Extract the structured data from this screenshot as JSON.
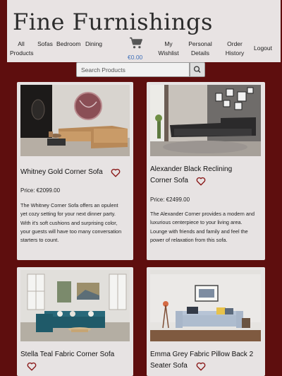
{
  "site": {
    "title": "Fine Furnishings"
  },
  "nav": {
    "all_products": "All Products",
    "sofas": "Sofas",
    "bedroom": "Bedroom",
    "dining": "Dining",
    "cart_total": "€0.00",
    "wishlist": "My Wishlist",
    "personal_details": "Personal Details",
    "order_history": "Order History",
    "logout": "Logout"
  },
  "search": {
    "placeholder": "Search Products"
  },
  "products": [
    {
      "name": "Whitney Gold Corner Sofa",
      "price": "Price: €2099.00",
      "description": "The Whitney Corner Sofa offers an opulent yet cozy setting for your next dinner party. With it's soft cushions and surprising color, your guests will have too many conversation starters to count."
    },
    {
      "name": "Alexander Black Reclining Corner Sofa",
      "price": "Price: €2499.00",
      "description": "The Alexander Corner provides a modern and luxurious centerpiece to your living area. Lounge with friends and family and feel the power of relaxation from this sofa."
    },
    {
      "name": "Stella Teal Fabric Corner Sofa",
      "price": "",
      "description": ""
    },
    {
      "name": "Emma Grey Fabric Pillow Back 2 Seater Sofa",
      "price": "",
      "description": ""
    }
  ],
  "colors": {
    "page_background": "#5e0e0e",
    "header_background": "#e8e3e3",
    "card_background": "#e7e3e3",
    "heart": "#8a1a1a",
    "cart_price": "#3d6eb8"
  },
  "icons": {
    "cart": "shopping-cart-icon",
    "search": "search-icon",
    "wishlist": "heart-outline-icon"
  }
}
